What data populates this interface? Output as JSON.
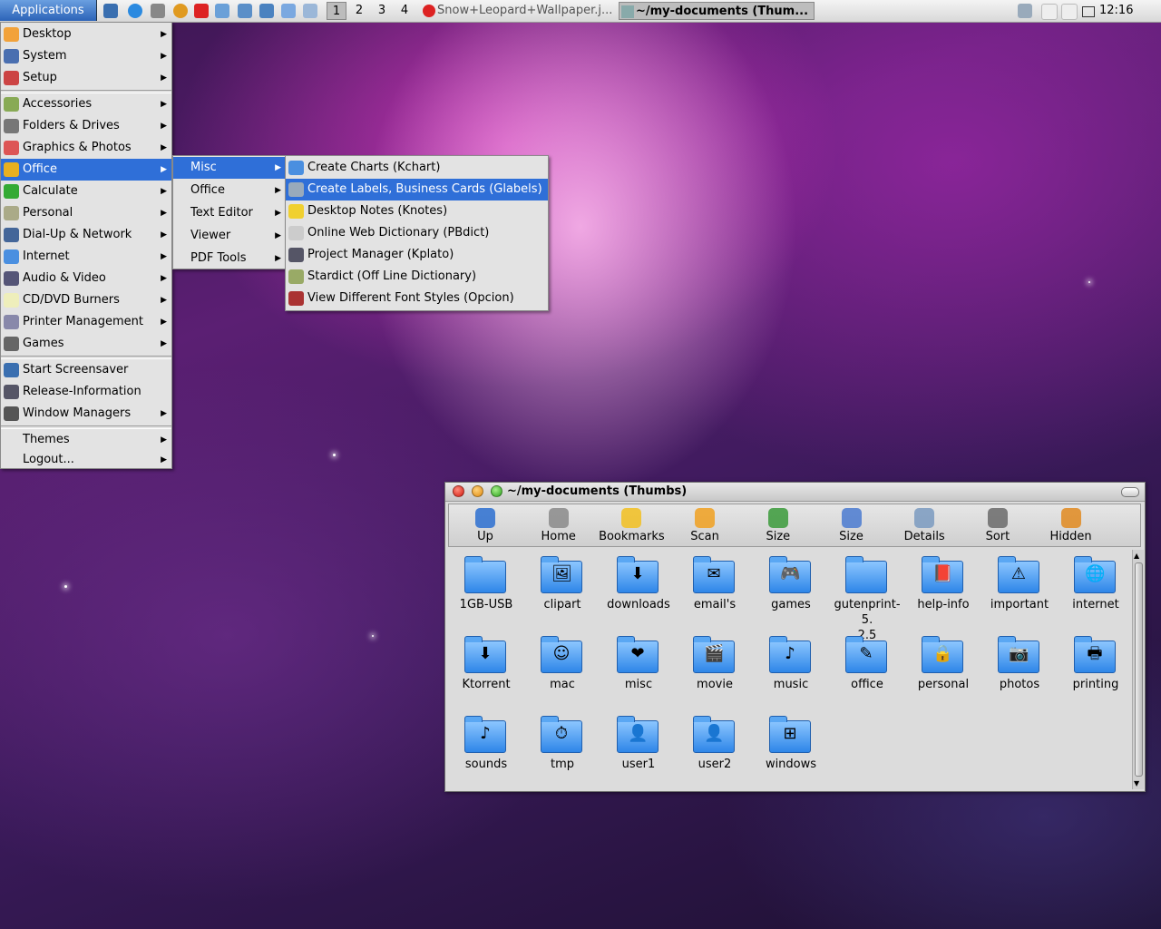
{
  "panel": {
    "apps_label": "Applications",
    "workspaces": [
      "1",
      "2",
      "3",
      "4"
    ],
    "tasks": [
      {
        "label": "Snow+Leopard+Wallpaper.j..."
      },
      {
        "label": "~/my-documents (Thum..."
      }
    ],
    "clock": "12:16"
  },
  "main_menu": {
    "groups": [
      [
        {
          "label": "Desktop",
          "icon": "desktop-icon",
          "submenu": true
        },
        {
          "label": "System",
          "icon": "system-icon",
          "submenu": true
        },
        {
          "label": "Setup",
          "icon": "setup-icon",
          "submenu": true
        }
      ],
      [
        {
          "label": "Accessories",
          "icon": "accessories-icon",
          "submenu": true
        },
        {
          "label": "Folders & Drives",
          "icon": "folders-icon",
          "submenu": true
        },
        {
          "label": "Graphics & Photos",
          "icon": "graphics-icon",
          "submenu": true
        },
        {
          "label": "Office",
          "icon": "office-icon",
          "submenu": true,
          "selected": true
        },
        {
          "label": "Calculate",
          "icon": "calculate-icon",
          "submenu": true
        },
        {
          "label": "Personal",
          "icon": "personal-icon",
          "submenu": true
        },
        {
          "label": "Dial-Up & Network",
          "icon": "network-icon",
          "submenu": true
        },
        {
          "label": "Internet",
          "icon": "internet-icon",
          "submenu": true
        },
        {
          "label": "Audio & Video",
          "icon": "audio-video-icon",
          "submenu": true
        },
        {
          "label": "CD/DVD Burners",
          "icon": "cd-icon",
          "submenu": true
        },
        {
          "label": "Printer Management",
          "icon": "printer-icon",
          "submenu": true
        },
        {
          "label": "Games",
          "icon": "games-icon",
          "submenu": true
        }
      ],
      [
        {
          "label": "Start Screensaver",
          "icon": "screensaver-icon",
          "submenu": false
        },
        {
          "label": "Release-Information",
          "icon": "info-icon",
          "submenu": false
        },
        {
          "label": "Window Managers",
          "icon": "window-managers-icon",
          "submenu": true
        }
      ],
      [
        {
          "label": "Themes",
          "icon": "",
          "submenu": true
        },
        {
          "label": "Logout...",
          "icon": "",
          "submenu": true
        }
      ]
    ]
  },
  "office_menu": [
    {
      "label": "Misc",
      "selected": true
    },
    {
      "label": "Office"
    },
    {
      "label": "Text Editor"
    },
    {
      "label": "Viewer"
    },
    {
      "label": "PDF Tools"
    }
  ],
  "misc_menu": [
    {
      "label": "Create Charts (Kchart)",
      "icon": "chart-icon"
    },
    {
      "label": "Create Labels, Business Cards (Glabels)",
      "icon": "labels-icon",
      "selected": true
    },
    {
      "label": "Desktop Notes (Knotes)",
      "icon": "notes-icon"
    },
    {
      "label": "Online Web Dictionary (PBdict)",
      "icon": "dictionary-icon"
    },
    {
      "label": "Project Manager (Kplato)",
      "icon": "project-icon"
    },
    {
      "label": "Stardict (Off Line Dictionary)",
      "icon": "stardict-icon"
    },
    {
      "label": "View Different Font Styles (Opcion)",
      "icon": "font-icon"
    }
  ],
  "window": {
    "title": "~/my-documents (Thumbs)",
    "toolbar": [
      {
        "label": "Up",
        "icon": "up-arrow-icon"
      },
      {
        "label": "Home",
        "icon": "home-icon"
      },
      {
        "label": "Bookmarks",
        "icon": "star-icon"
      },
      {
        "label": "Scan",
        "icon": "refresh-icon"
      },
      {
        "label": "Size",
        "icon": "zoom-in-icon"
      },
      {
        "label": "Size",
        "icon": "zoom-out-icon"
      },
      {
        "label": "Details",
        "icon": "details-icon"
      },
      {
        "label": "Sort",
        "icon": "sort-icon"
      },
      {
        "label": "Hidden",
        "icon": "lock-icon"
      }
    ],
    "items": [
      {
        "label": "1GB-USB",
        "emblem": ""
      },
      {
        "label": "clipart",
        "emblem": "🖼"
      },
      {
        "label": "downloads",
        "emblem": "⬇"
      },
      {
        "label": "email's",
        "emblem": "✉"
      },
      {
        "label": "games",
        "emblem": "🎮"
      },
      {
        "label": "gutenprint-5.\n2.5",
        "emblem": ""
      },
      {
        "label": "help-info",
        "emblem": "📕"
      },
      {
        "label": "important",
        "emblem": "⚠"
      },
      {
        "label": "internet",
        "emblem": "🌐"
      },
      {
        "label": "Ktorrent",
        "emblem": "⬇"
      },
      {
        "label": "mac",
        "emblem": "☺"
      },
      {
        "label": "misc",
        "emblem": "❤"
      },
      {
        "label": "movie",
        "emblem": "🎬"
      },
      {
        "label": "music",
        "emblem": "♪"
      },
      {
        "label": "office",
        "emblem": "✎"
      },
      {
        "label": "personal",
        "emblem": "🔒"
      },
      {
        "label": "photos",
        "emblem": "📷"
      },
      {
        "label": "printing",
        "emblem": "🖶"
      },
      {
        "label": "sounds",
        "emblem": "♪"
      },
      {
        "label": "tmp",
        "emblem": "⏱"
      },
      {
        "label": "user1",
        "emblem": "👤"
      },
      {
        "label": "user2",
        "emblem": "👤"
      },
      {
        "label": "windows",
        "emblem": "⊞"
      }
    ]
  }
}
